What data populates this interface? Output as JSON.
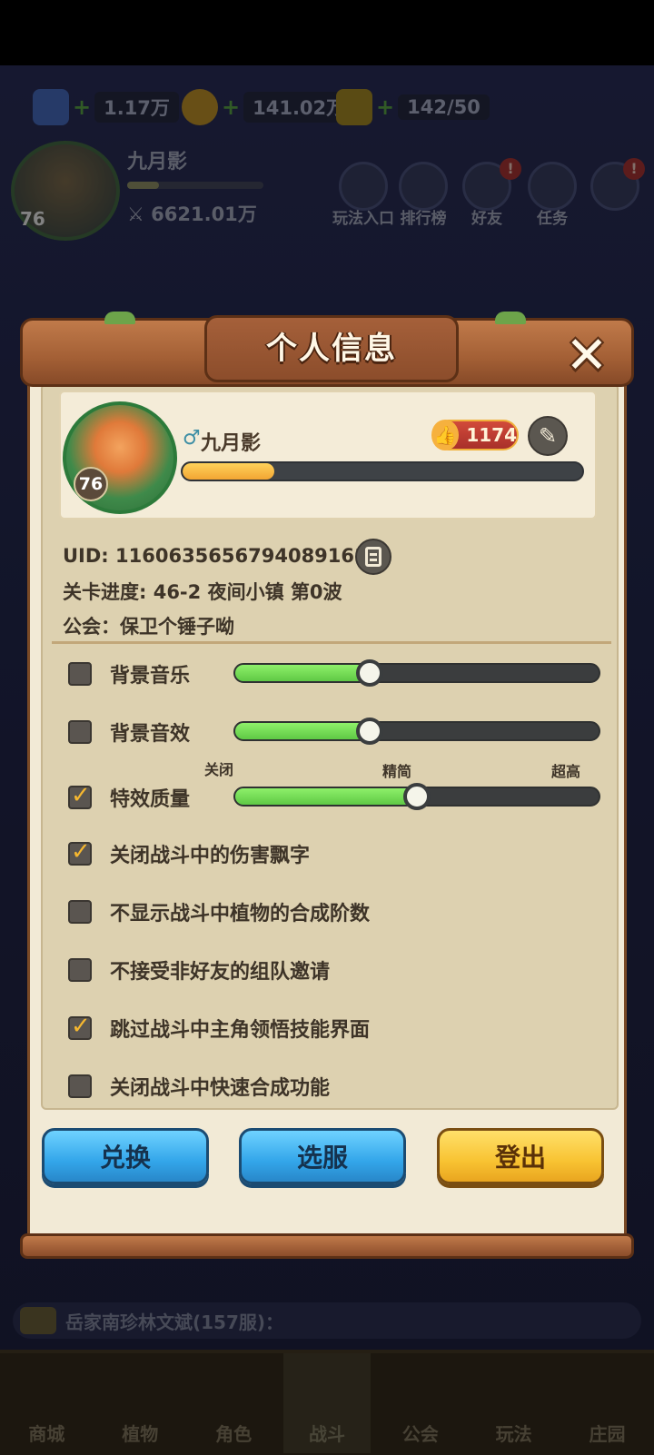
{
  "hud": {
    "diamonds": "1.17万",
    "coins": "141.02万",
    "energy": "142/50",
    "player_name": "九月影",
    "level": "76",
    "power": "6621.01万",
    "icons": [
      {
        "label": "玩法入口",
        "icon": "gamepad-icon"
      },
      {
        "label": "排行榜",
        "icon": "ranking-icon"
      },
      {
        "label": "好友",
        "icon": "friends-icon"
      },
      {
        "label": "任务",
        "icon": "tasks-icon"
      }
    ]
  },
  "chat": {
    "text": "岳家南珍林文斌(157服)："
  },
  "nav": [
    "商城",
    "植物",
    "角色",
    "战斗",
    "公会",
    "玩法",
    "庄园"
  ],
  "dialog": {
    "title": "个人信息",
    "profile": {
      "name": "九月影",
      "level": "76",
      "likes": "1174",
      "gender_symbol": "♂",
      "xp_fraction": 0.23
    },
    "uid": "UID: 1160635656794089161",
    "progress": "关卡进度: 46-2  夜间小镇 第0波",
    "guild": "公会：保卫个锤子呦",
    "settings": [
      {
        "label": "背景音乐",
        "checked": false,
        "slider_value": 0.37
      },
      {
        "label": "背景音效",
        "checked": false,
        "slider_value": 0.37
      },
      {
        "label": "特效质量",
        "checked": true,
        "slider_value": 0.5
      }
    ],
    "quality_labels": {
      "low": "关闭",
      "mid": "精简",
      "high": "超高"
    },
    "options": [
      {
        "label": "关闭战斗中的伤害飘字",
        "checked": true
      },
      {
        "label": "不显示战斗中植物的合成阶数",
        "checked": false
      },
      {
        "label": "不接受非好友的组队邀请",
        "checked": false
      },
      {
        "label": "跳过战斗中主角领悟技能界面",
        "checked": true
      },
      {
        "label": "关闭战斗中快速合成功能",
        "checked": false
      }
    ],
    "buttons": {
      "exchange": "兑换",
      "server": "选服",
      "logout": "登出"
    }
  },
  "colors": {
    "wood": "#a35f35",
    "parchment": "#f2ead6",
    "slider_green": "#5fc945",
    "check_yellow": "#f5b730",
    "btn_blue": "#33a6ea",
    "btn_yellow": "#f8c332"
  }
}
